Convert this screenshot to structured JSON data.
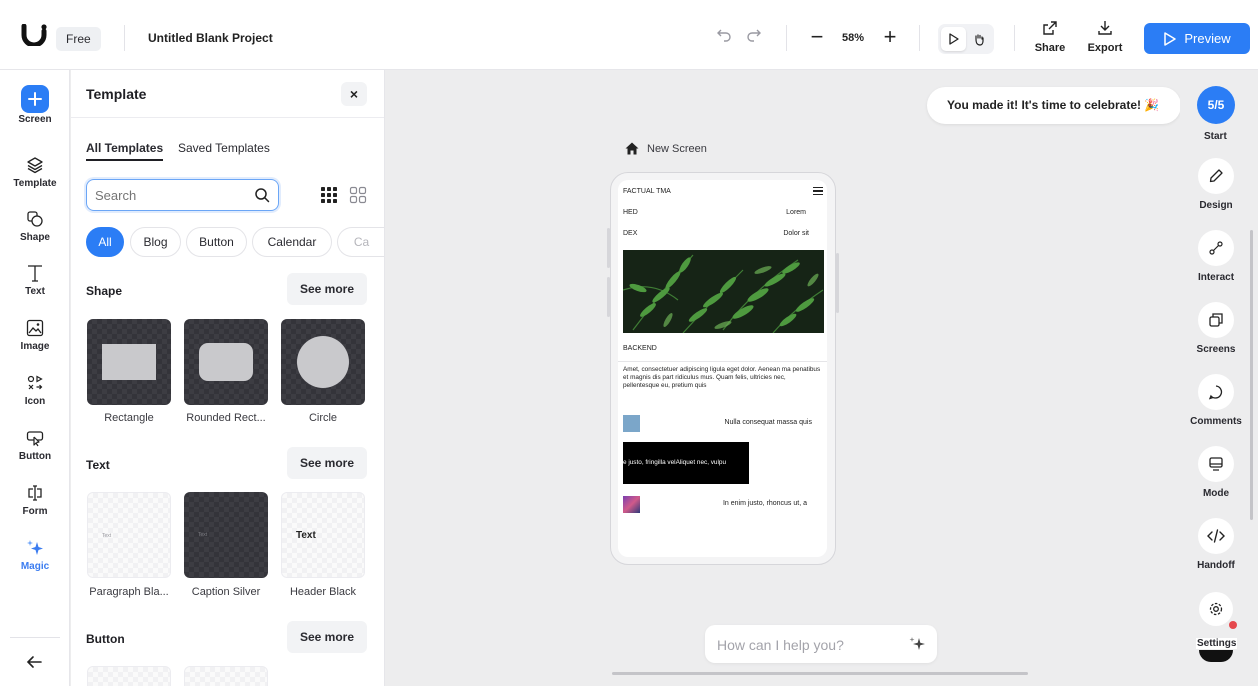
{
  "app": {
    "plan_badge": "Free",
    "project_title": "Untitled Blank Project"
  },
  "toolbar": {
    "zoom_level": "58%",
    "zoom_out_label": "−",
    "zoom_in_label": "+",
    "share_label": "Share",
    "export_label": "Export",
    "preview_label": "Preview"
  },
  "left_rail": {
    "items": [
      {
        "label": "Screen",
        "icon": "plus-icon"
      },
      {
        "label": "Template",
        "icon": "layers-icon"
      },
      {
        "label": "Shape",
        "icon": "shapes-icon"
      },
      {
        "label": "Text",
        "icon": "text-icon"
      },
      {
        "label": "Image",
        "icon": "image-icon"
      },
      {
        "label": "Icon",
        "icon": "icons-icon"
      },
      {
        "label": "Button",
        "icon": "button-icon"
      },
      {
        "label": "Form",
        "icon": "form-icon"
      },
      {
        "label": "Magic",
        "icon": "sparkle-icon"
      }
    ],
    "magic_color": "#3b7cf0"
  },
  "template_panel": {
    "title": "Template",
    "close_label": "×",
    "tabs": [
      {
        "label": "All Templates",
        "active": true
      },
      {
        "label": "Saved Templates",
        "active": false
      }
    ],
    "search": {
      "placeholder": "Search",
      "value": ""
    },
    "chips": [
      {
        "label": "All",
        "active": true
      },
      {
        "label": "Blog",
        "active": false
      },
      {
        "label": "Button",
        "active": false
      },
      {
        "label": "Calendar",
        "active": false
      },
      {
        "label": "Ca",
        "active": false
      }
    ],
    "sections": [
      {
        "title": "Shape",
        "see_more": "See more",
        "items": [
          "Rectangle",
          "Rounded Rect...",
          "Circle"
        ]
      },
      {
        "title": "Text",
        "see_more": "See more",
        "items": [
          "Paragraph Bla...",
          "Caption Silver",
          "Header Black"
        ],
        "thumb_text": [
          "Text",
          "Text",
          "Text"
        ]
      },
      {
        "title": "Button",
        "see_more": "See more",
        "items": []
      }
    ]
  },
  "canvas": {
    "celebrate_message": "You made it! It's time to celebrate! 🎉",
    "screen_name": "New Screen",
    "phone": {
      "brand": "FACTUAL TMA",
      "row1_left": "HED",
      "row1_right": "Lorem",
      "row2_left": "DEX",
      "row2_right": "Dolor sit",
      "section": "BACKEND",
      "paragraph": "Amet, consectetuer adipiscing ligula eget dolor. Aenean ma penatibus et magnis dis part ridiculus mus. Quam felis, ultricies nec, pellentesque eu, pretium quis",
      "item1_text": "Nulla consequat massa quis",
      "dark_banner": "e justo, fringilla velAliquet nec, vulpu",
      "item2_text": "In enim justo, rhoncus ut, a"
    },
    "ai_input_placeholder": "How can I help you?"
  },
  "right_rail": {
    "progress": "5/5",
    "start_label": "Start",
    "items": [
      {
        "label": "Design",
        "icon": "pen-icon"
      },
      {
        "label": "Interact",
        "icon": "interact-icon"
      },
      {
        "label": "Screens",
        "icon": "screens-icon"
      },
      {
        "label": "Comments",
        "icon": "comment-icon"
      },
      {
        "label": "Mode",
        "icon": "monitor-icon"
      },
      {
        "label": "Handoff",
        "icon": "code-icon"
      }
    ],
    "settings_label": "Settings"
  },
  "colors": {
    "accent": "#2b7df5",
    "canvas_bg": "#ededee",
    "notification": "#e5484d"
  }
}
